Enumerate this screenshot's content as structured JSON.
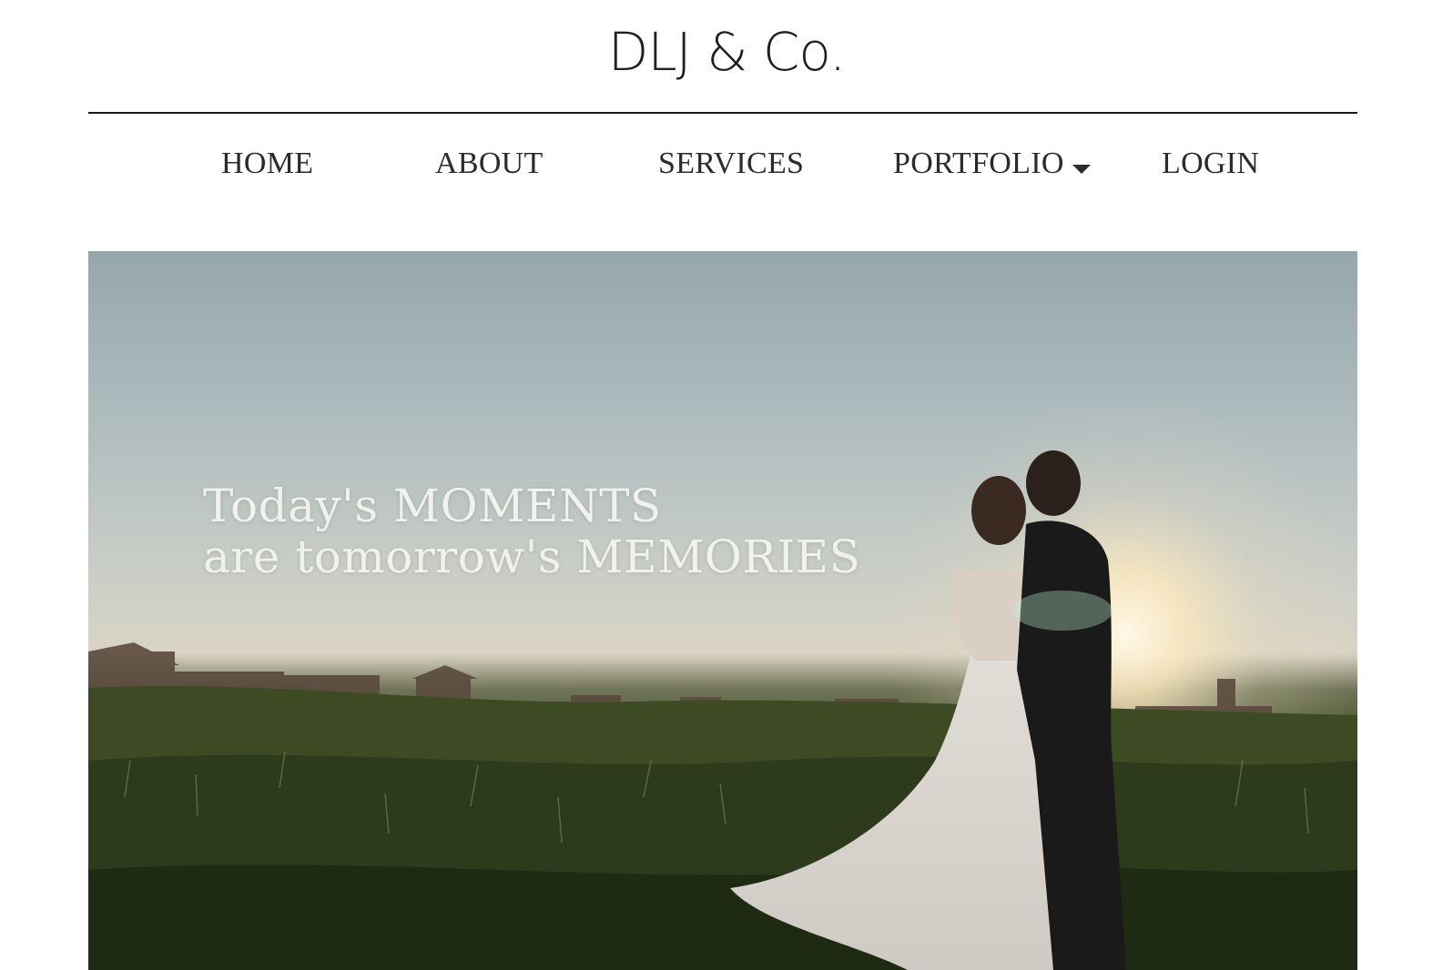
{
  "brand": {
    "name": "DLJ & Co."
  },
  "nav": {
    "items": [
      {
        "label": "HOME"
      },
      {
        "label": "ABOUT"
      },
      {
        "label": "SERVICES"
      },
      {
        "label": "PORTFOLIO"
      },
      {
        "label": "LOGIN"
      }
    ]
  },
  "hero": {
    "tagline_line1": "Today's MOMENTS",
    "tagline_line2": "are tomorrow's MEMORIES"
  },
  "colors": {
    "text": "#2b2b2b",
    "rule": "#1a1a1a",
    "tagline": "#f1f1ee",
    "sky": "#a9b7ba",
    "grass": "#33401f"
  }
}
